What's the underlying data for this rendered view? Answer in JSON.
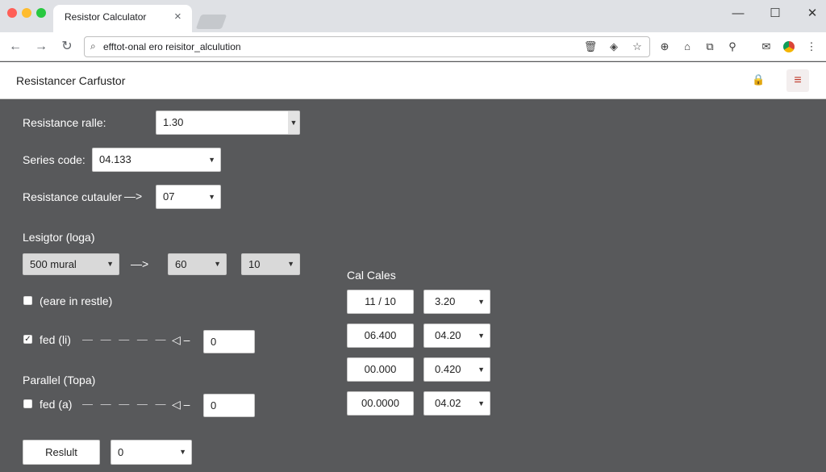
{
  "browser": {
    "tab_title": "Resistor Calculator",
    "tab_close": "×",
    "url": "efftot-onal ero reisitor_alculution",
    "window_controls": {
      "minimize": "—",
      "maximize": "☐",
      "close": "✕"
    }
  },
  "app": {
    "title": "Resistancer Carfustor"
  },
  "form": {
    "resistance_value": {
      "label": "Resistance ralle:",
      "value": "1.30"
    },
    "series_code": {
      "label": "Series code:",
      "value": "04.133"
    },
    "resistance_calculator": {
      "label": "Resistance cutauler",
      "value": "07"
    },
    "legistor": {
      "heading": "Lesigtor (loga)",
      "select_a": "500 mural",
      "select_b": "60",
      "select_c": "10"
    },
    "checkbox_one": {
      "label": "(eare in restle)",
      "checked": false
    },
    "checkbox_two": {
      "label": "fed (li)",
      "checked": true,
      "value": "0"
    },
    "parallel": {
      "heading": "Parallel (Topa)",
      "checkbox_label": "fed (a)",
      "checked": false,
      "value": "0"
    },
    "result_button": "Reslult",
    "result_value": "0"
  },
  "cal_cales": {
    "heading": "Cal Cales",
    "rows": [
      {
        "left": "11  /  10",
        "right": "3.20"
      },
      {
        "left": "06.400",
        "right": "04.20"
      },
      {
        "left": "00.000",
        "right": "0.420"
      },
      {
        "left": "00.0000",
        "right": "04.02"
      }
    ]
  },
  "icons": {
    "menu": "hamburger-menu-icon",
    "lock": "lock-icon"
  },
  "colors": {
    "background": "#58595b",
    "menu_accent": "#c0392b"
  }
}
